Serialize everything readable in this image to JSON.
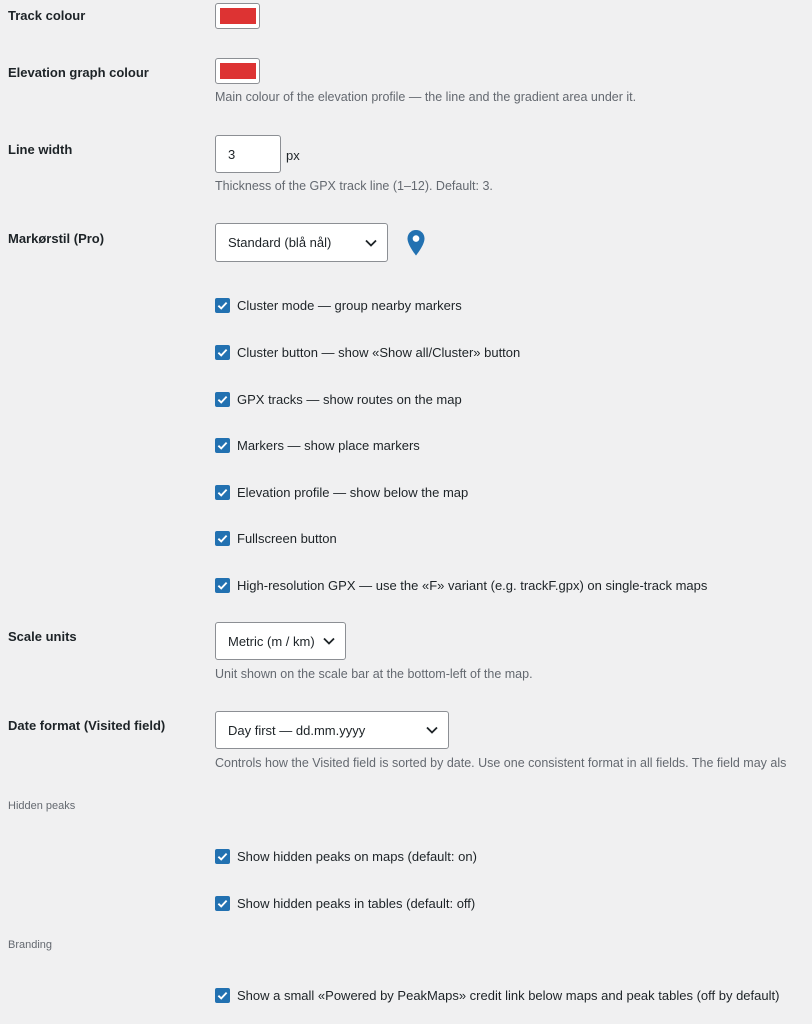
{
  "settings": {
    "track_colour": {
      "label": "Track colour",
      "color": "#dd3333"
    },
    "elevation_colour": {
      "label": "Elevation graph colour",
      "color": "#dd3333",
      "description": "Main colour of the elevation profile — the line and the gradient area under it."
    },
    "line_width": {
      "label": "Line width",
      "value": "3",
      "unit": "px",
      "description": "Thickness of the GPX track line (1–12). Default: 3."
    },
    "marker_style": {
      "label": "Markørstil (Pro)",
      "selected": "Standard (blå nål)",
      "icon": "map-pin-icon",
      "icon_color": "#2271b1"
    },
    "checkboxes": [
      {
        "label": "Cluster mode — group nearby markers",
        "checked": true
      },
      {
        "label": "Cluster button — show «Show all/Cluster» button",
        "checked": true
      },
      {
        "label": "GPX tracks — show routes on the map",
        "checked": true
      },
      {
        "label": "Markers — show place markers",
        "checked": true
      },
      {
        "label": "Elevation profile — show below the map",
        "checked": true
      },
      {
        "label": "Fullscreen button",
        "checked": true
      },
      {
        "label": "High-resolution GPX — use the «F» variant (e.g. trackF.gpx) on single-track maps",
        "checked": true
      }
    ],
    "scale_units": {
      "label": "Scale units",
      "selected": "Metric (m / km)",
      "description": "Unit shown on the scale bar at the bottom-left of the map."
    },
    "date_format": {
      "label": "Date format (Visited field)",
      "selected": "Day first — dd.mm.yyyy",
      "description": "Controls how the Visited field is sorted by date. Use one consistent format in all fields. The field may als"
    },
    "hidden_peaks": {
      "heading": "Hidden peaks",
      "checkboxes": [
        {
          "label": "Show hidden peaks on maps (default: on)",
          "checked": true
        },
        {
          "label": "Show hidden peaks in tables (default: off)",
          "checked": true
        }
      ]
    },
    "branding": {
      "heading": "Branding",
      "checkboxes": [
        {
          "label": "Show a small «Powered by PeakMaps» credit link below maps and peak tables (off by default)",
          "checked": true
        }
      ]
    }
  },
  "colors": {
    "accent": "#2271b1",
    "background": "#f0f0f1"
  }
}
